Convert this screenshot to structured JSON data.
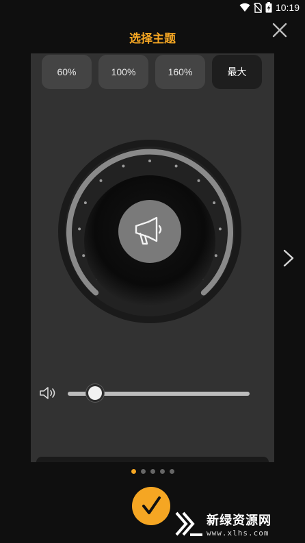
{
  "status_bar": {
    "time": "10:19"
  },
  "header": {
    "title": "选择主题"
  },
  "presets": [
    "60%",
    "100%",
    "160%",
    "最大"
  ],
  "selected_preset": "最大",
  "volume": {
    "level": 0.12
  },
  "pagination": {
    "count": 5,
    "active_index": 0
  },
  "watermark": {
    "title": "新绿资源网",
    "url": "www.xlhs.com"
  },
  "colors": {
    "accent": "#f5a623",
    "card": "#323232",
    "background": "#0f0f0f"
  },
  "icons": {
    "close": "close-icon",
    "megaphone": "megaphone-icon",
    "speaker": "speaker-icon",
    "next": "chevron-right-icon",
    "confirm": "checkmark-icon"
  }
}
